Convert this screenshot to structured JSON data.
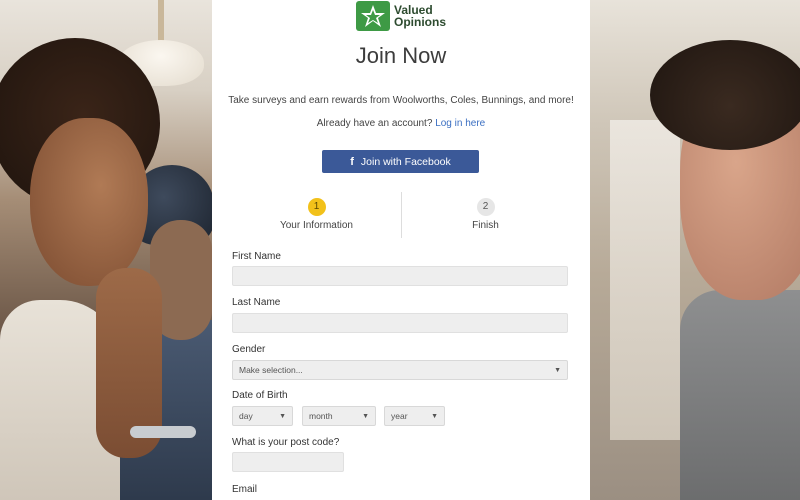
{
  "brand": {
    "name_line1": "Valued",
    "name_line2": "Opinions"
  },
  "page": {
    "title": "Join Now",
    "tagline": "Take surveys and earn rewards from Woolworths, Coles, Bunnings, and more!",
    "account_prompt": "Already have an account?",
    "login_link": "Log in here"
  },
  "facebook_button": {
    "label": "Join with Facebook",
    "icon": "f"
  },
  "steps": [
    {
      "number": "1",
      "label": "Your Information"
    },
    {
      "number": "2",
      "label": "Finish"
    }
  ],
  "form": {
    "first_name": {
      "label": "First Name",
      "value": ""
    },
    "last_name": {
      "label": "Last Name",
      "value": ""
    },
    "gender": {
      "label": "Gender",
      "selected": "Make selection..."
    },
    "dob": {
      "label": "Date of Birth",
      "day": "day",
      "month": "month",
      "year": "year"
    },
    "post_code": {
      "label": "What is your post code?",
      "value": ""
    },
    "email": {
      "label": "Email"
    }
  },
  "colors": {
    "facebook": "#3b5998",
    "step_active": "#f2c11a",
    "link": "#3b6fc2",
    "brand_green": "#3e9a45"
  }
}
